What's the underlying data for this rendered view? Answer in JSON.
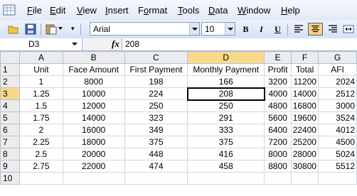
{
  "menu": [
    "File",
    "Edit",
    "View",
    "Insert",
    "Format",
    "Tools",
    "Data",
    "Window",
    "Help"
  ],
  "menu_access_keys": [
    "F",
    "E",
    "V",
    "I",
    "o",
    "T",
    "D",
    "W",
    "H"
  ],
  "toolbar": {
    "font_name": "Arial",
    "font_size": "10",
    "bold_label": "B",
    "italic_label": "I",
    "underline_label": "U",
    "icons": [
      "open-icon",
      "save-icon",
      "paste-icon"
    ],
    "active_alignment": "center"
  },
  "formula_bar": {
    "name_box": "D3",
    "fx_label": "fx",
    "value": "208"
  },
  "columns": [
    "A",
    "B",
    "C",
    "D",
    "E",
    "F",
    "G"
  ],
  "selected_column": "D",
  "selected_row": "3",
  "rows": [
    {
      "row": "1",
      "cells": [
        "Unit",
        "Face Amount",
        "First Payment",
        "Monthly Payment",
        "Profit",
        "Total",
        "AFI"
      ]
    },
    {
      "row": "2",
      "cells": [
        "1",
        "8000",
        "198",
        "166",
        "3200",
        "11200",
        "2024"
      ]
    },
    {
      "row": "3",
      "cells": [
        "1.25",
        "10000",
        "224",
        "208",
        "4000",
        "14000",
        "2512"
      ]
    },
    {
      "row": "4",
      "cells": [
        "1.5",
        "12000",
        "250",
        "250",
        "4800",
        "16800",
        "3000"
      ]
    },
    {
      "row": "5",
      "cells": [
        "1.75",
        "14000",
        "323",
        "291",
        "5600",
        "19600",
        "3524"
      ]
    },
    {
      "row": "6",
      "cells": [
        "2",
        "16000",
        "349",
        "333",
        "6400",
        "22400",
        "4012"
      ]
    },
    {
      "row": "7",
      "cells": [
        "2.25",
        "18000",
        "375",
        "375",
        "7200",
        "25200",
        "4500"
      ]
    },
    {
      "row": "8",
      "cells": [
        "2.5",
        "20000",
        "448",
        "416",
        "8000",
        "28000",
        "5024"
      ]
    },
    {
      "row": "9",
      "cells": [
        "2.75",
        "22000",
        "474",
        "458",
        "8800",
        "30800",
        "5512"
      ]
    },
    {
      "row": "10",
      "cells": [
        "",
        "",
        "",
        "",
        "",
        "",
        ""
      ]
    }
  ]
}
